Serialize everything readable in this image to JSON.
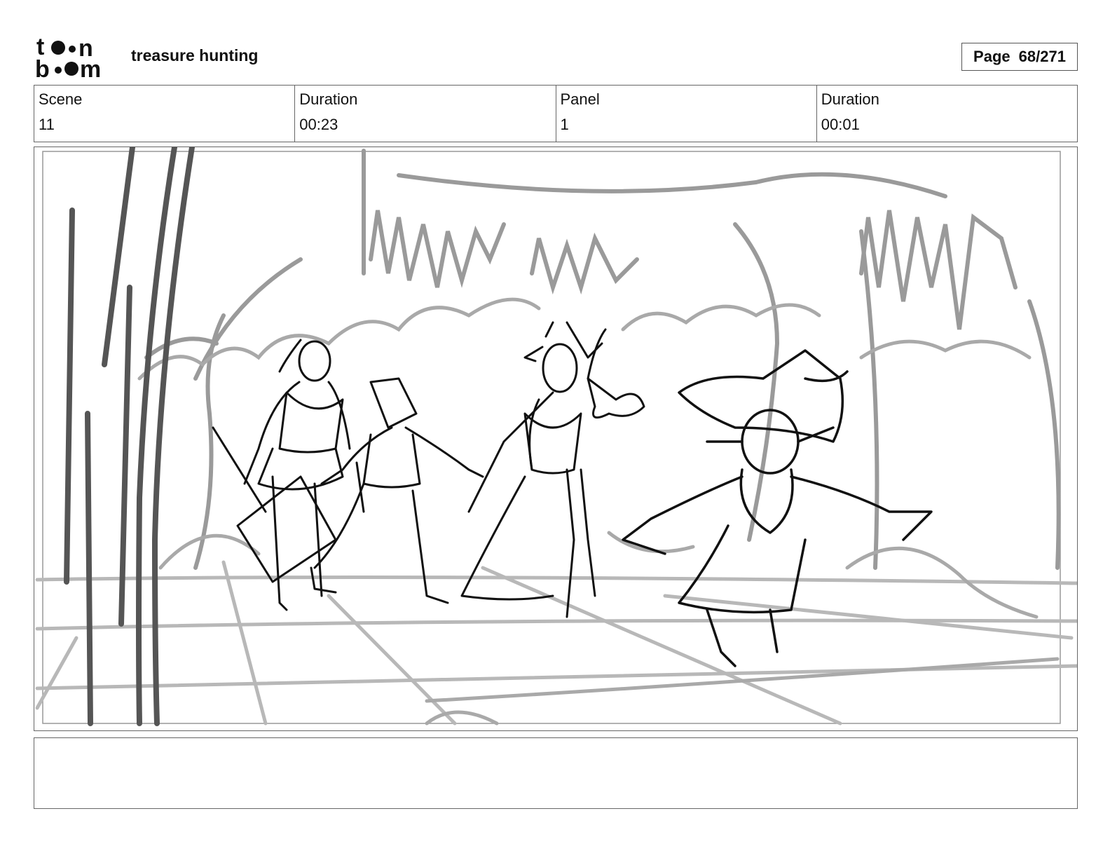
{
  "header": {
    "brand_logo": "toon boom",
    "title": "treasure hunting",
    "page_label": "Page",
    "page_value": "68/271"
  },
  "info": {
    "scene_label": "Scene",
    "scene_value": "11",
    "scene_duration_label": "Duration",
    "scene_duration_value": "00:23",
    "panel_label": "Panel",
    "panel_value": "1",
    "panel_duration_label": "Duration",
    "panel_duration_value": "00:01"
  },
  "notes": {
    "text": ""
  }
}
